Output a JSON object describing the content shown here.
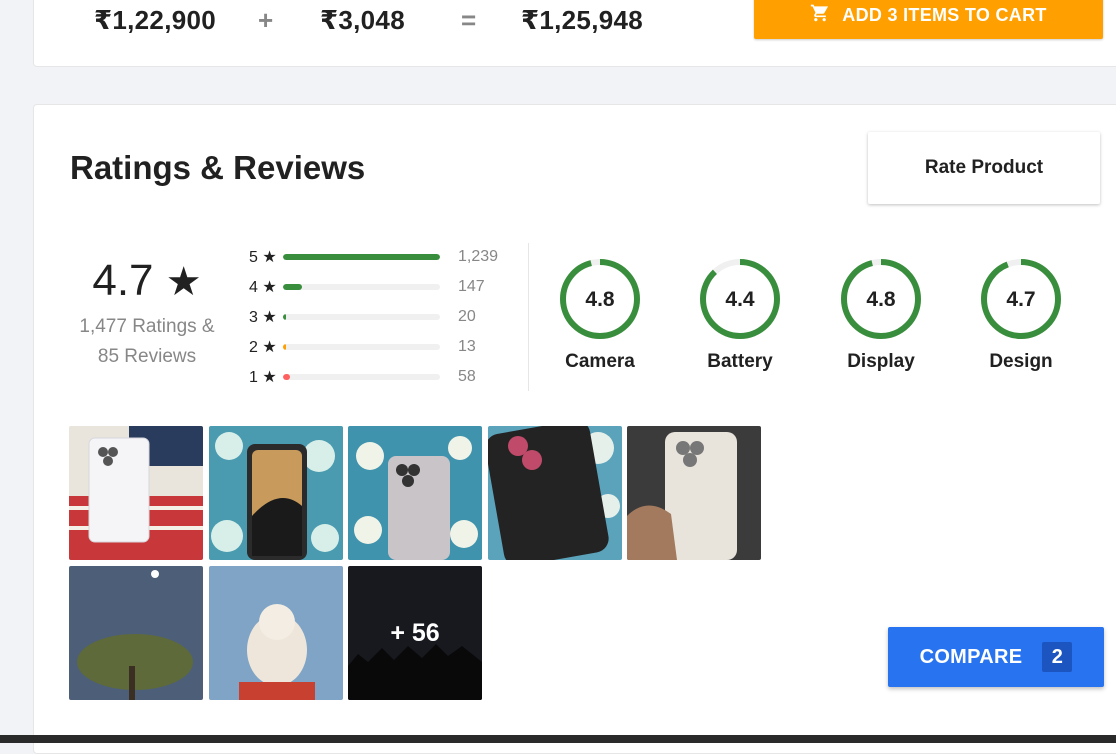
{
  "combo": {
    "price_1": "₹1,22,900",
    "op_plus": "+",
    "price_2": "₹3,048",
    "op_equals": "=",
    "total": "₹1,25,948",
    "add_to_cart_label": "ADD 3 ITEMS TO CART"
  },
  "reviews": {
    "title": "Ratings & Reviews",
    "rate_product_label": "Rate Product",
    "overall_rating": "4.7",
    "star_glyph": "★",
    "ratings_line": "1,477 Ratings &",
    "reviews_line": "85 Reviews",
    "distribution": [
      {
        "label": "5 ★",
        "count": "1,239",
        "fraction": 1.0,
        "color": "#388e3c"
      },
      {
        "label": "4 ★",
        "count": "147",
        "fraction": 0.119,
        "color": "#388e3c"
      },
      {
        "label": "3 ★",
        "count": "20",
        "fraction": 0.016,
        "color": "#388e3c"
      },
      {
        "label": "2 ★",
        "count": "13",
        "fraction": 0.011,
        "color": "#ff9f00"
      },
      {
        "label": "1 ★",
        "count": "58",
        "fraction": 0.047,
        "color": "#ff6161"
      }
    ],
    "aspects": [
      {
        "name": "Camera",
        "score": "4.8",
        "fraction": 0.96
      },
      {
        "name": "Battery",
        "score": "4.4",
        "fraction": 0.88
      },
      {
        "name": "Display",
        "score": "4.8",
        "fraction": 0.96
      },
      {
        "name": "Design",
        "score": "4.7",
        "fraction": 0.94
      }
    ],
    "more_photos_label": "+ 56"
  },
  "compare": {
    "label": "COMPARE",
    "count": "2"
  },
  "colors": {
    "accent_orange": "#ff9f00",
    "accent_blue": "#2874f0",
    "rating_green": "#388e3c"
  }
}
